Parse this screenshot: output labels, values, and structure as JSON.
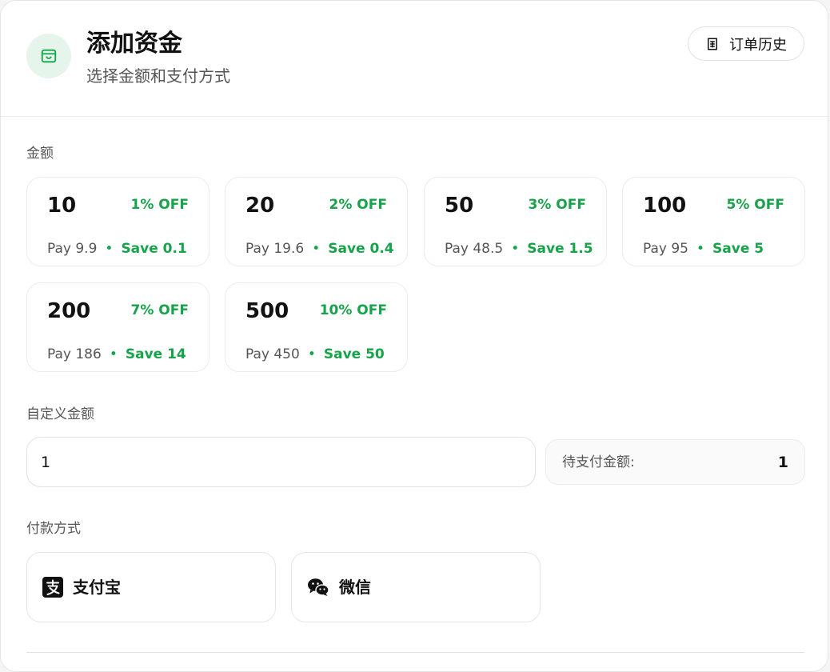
{
  "header": {
    "title": "添加资金",
    "subtitle": "选择金额和支付方式",
    "history_button": "订单历史",
    "icon": "wallet-icon",
    "accent": "#16a34a"
  },
  "amount_section": {
    "label": "金额",
    "presets": [
      {
        "amount": "10",
        "discount": "1% OFF",
        "pay": "Pay 9.9",
        "save": "Save 0.1"
      },
      {
        "amount": "20",
        "discount": "2% OFF",
        "pay": "Pay 19.6",
        "save": "Save 0.4"
      },
      {
        "amount": "50",
        "discount": "3% OFF",
        "pay": "Pay 48.5",
        "save": "Save 1.5"
      },
      {
        "amount": "100",
        "discount": "5% OFF",
        "pay": "Pay 95",
        "save": "Save 5"
      },
      {
        "amount": "200",
        "discount": "7% OFF",
        "pay": "Pay 186",
        "save": "Save 14"
      },
      {
        "amount": "500",
        "discount": "10% OFF",
        "pay": "Pay 450",
        "save": "Save 50"
      }
    ],
    "separator": "•"
  },
  "custom_section": {
    "label": "自定义金额",
    "input_value": "1",
    "pending_label": "待支付金额:",
    "pending_value": "1"
  },
  "payment_section": {
    "label": "付款方式",
    "methods": [
      {
        "label": "支付宝",
        "icon": "alipay-icon"
      },
      {
        "label": "微信",
        "icon": "wechat-icon"
      }
    ]
  }
}
